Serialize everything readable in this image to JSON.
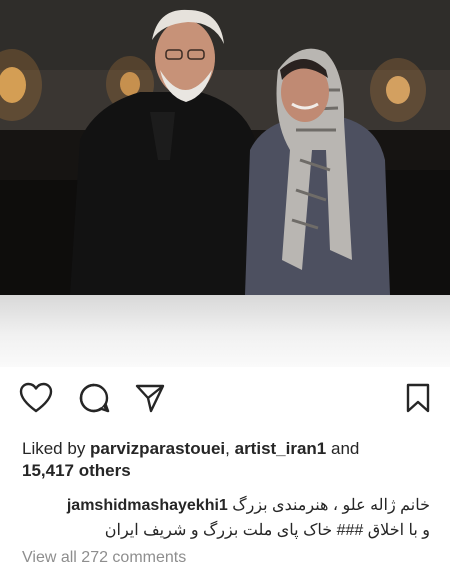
{
  "post": {
    "photo": "photo-of-two-people"
  },
  "actions": {
    "like_icon": "heart-icon",
    "comment_icon": "comment-icon",
    "share_icon": "share-icon",
    "save_icon": "bookmark-icon"
  },
  "likes": {
    "prefix": "Liked by ",
    "user1": "parvizparastouei",
    "separator": ", ",
    "user2": "artist_iran1",
    "and": " and",
    "others_count": "15,417",
    "others_label": " others"
  },
  "caption": {
    "author": "jamshidmashayekhi1",
    "line1": "خانم ژاله علو ، هنرمندی بزرگ",
    "line2": "و با اخلاق ### خاک پای ملت بزرگ و شریف ایران"
  },
  "comments": {
    "view_all": "View all 272 comments"
  }
}
